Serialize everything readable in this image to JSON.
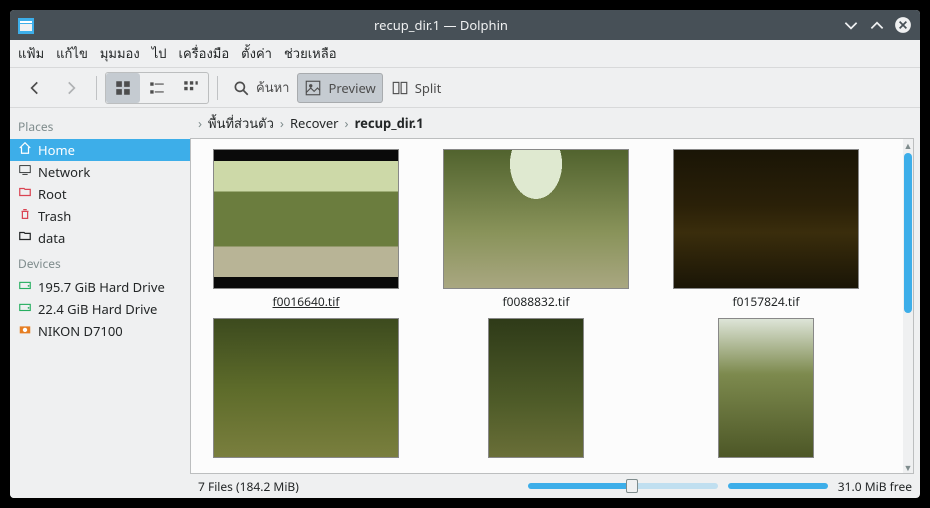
{
  "titlebar": {
    "title": "recup_dir.1 — Dolphin"
  },
  "menubar": [
    "แฟ้ม",
    "แก้ไข",
    "มุมมอง",
    "ไป",
    "เครื่องมือ",
    "ตั้งค่า",
    "ช่วยเหลือ"
  ],
  "toolbar": {
    "search_label": "ค้นหา",
    "preview_label": "Preview",
    "split_label": "Split"
  },
  "sidebar": {
    "places_header": "Places",
    "places": [
      {
        "label": "Home",
        "icon": "home",
        "selected": true,
        "color": "#fff"
      },
      {
        "label": "Network",
        "icon": "network",
        "color": "#232627"
      },
      {
        "label": "Root",
        "icon": "folder-red",
        "color": "#da4453"
      },
      {
        "label": "Trash",
        "icon": "trash",
        "color": "#da4453"
      },
      {
        "label": "data",
        "icon": "folder",
        "color": "#232627"
      }
    ],
    "devices_header": "Devices",
    "devices": [
      {
        "label": "195.7 GiB Hard Drive",
        "icon": "drive"
      },
      {
        "label": "22.4 GiB Hard Drive",
        "icon": "drive"
      },
      {
        "label": "NIKON D7100",
        "icon": "camera"
      }
    ]
  },
  "breadcrumb": [
    "พื้นที่ส่วนตัว",
    "Recover",
    "recup_dir.1"
  ],
  "files": [
    {
      "name": "f0016640.tif",
      "hover": true,
      "shape": "wide",
      "cls": "p1"
    },
    {
      "name": "f0088832.tif",
      "shape": "wide",
      "cls": "p2"
    },
    {
      "name": "f0157824.tif",
      "shape": "wide",
      "cls": "p3"
    },
    {
      "name": "",
      "shape": "wide",
      "cls": "p4"
    },
    {
      "name": "",
      "shape": "narrow",
      "cls": "p5"
    },
    {
      "name": "",
      "shape": "narrow",
      "cls": "p6"
    }
  ],
  "statusbar": {
    "summary": "7 Files (184.2 MiB)",
    "free": "31.0 MiB free",
    "zoom_pct": 55
  }
}
